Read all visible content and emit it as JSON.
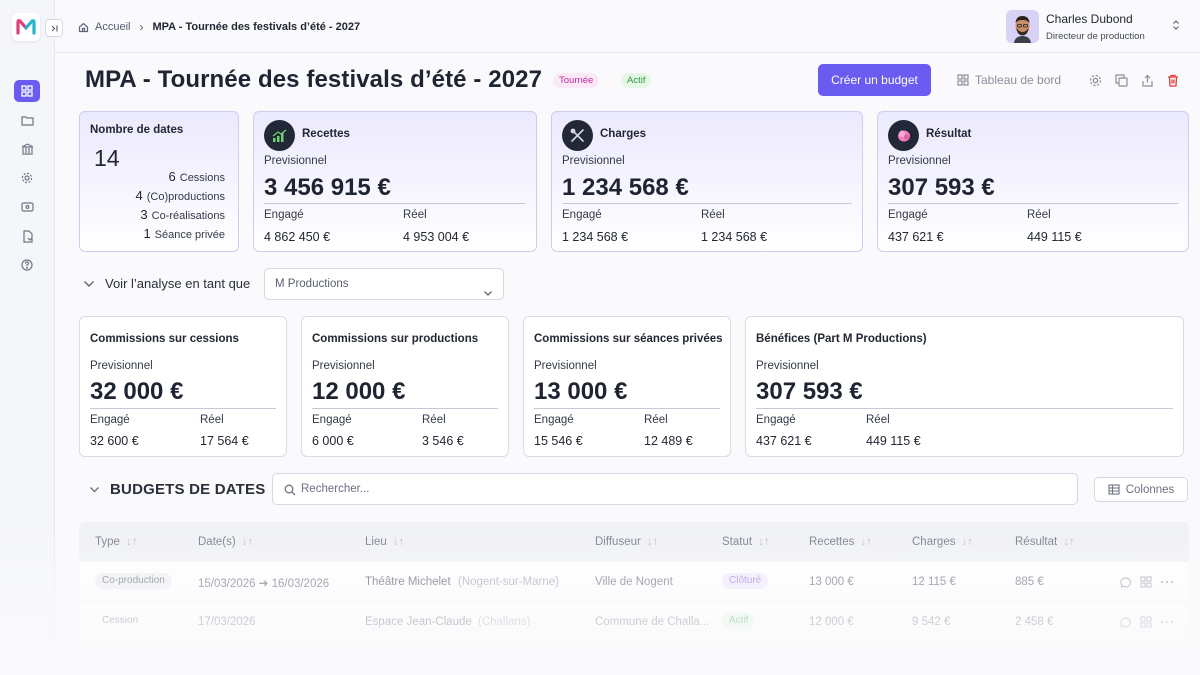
{
  "colors": {
    "accent": "#6a5cf0",
    "tag_tournee": "#c02ca0",
    "tag_actif": "#2f9a41"
  },
  "breadcrumb": {
    "home": "Accueil",
    "current": "MPA - Tournée des festivals d’été - 2027"
  },
  "user": {
    "name": "Charles Dubond",
    "role": "Directeur de production"
  },
  "header": {
    "title": "MPA - Tournée des festivals d’été - 2027",
    "tags": [
      "Tournée",
      "Actif"
    ],
    "create_button": "Créer un budget",
    "dashboard_link": "Tableau de bord"
  },
  "dates_card": {
    "title": "Nombre de dates",
    "total": "14",
    "items": [
      {
        "count": "6",
        "label": "Cessions"
      },
      {
        "count": "4",
        "label": "(Co)productions"
      },
      {
        "count": "3",
        "label": "Co-réalisations"
      },
      {
        "count": "1",
        "label": "Séance privée"
      }
    ]
  },
  "finance_cards": [
    {
      "title": "Recettes",
      "icon": "chart-up-icon",
      "prev_label": "Previsionnel",
      "prev": "3 456 915 €",
      "engage_label": "Engagé",
      "engage": "4 862 450 €",
      "reel_label": "Réel",
      "reel": "4 953 004 €"
    },
    {
      "title": "Charges",
      "icon": "tools-icon",
      "prev_label": "Previsionnel",
      "prev": "1 234 568 €",
      "engage_label": "Engagé",
      "engage": "1 234 568 €",
      "reel_label": "Réel",
      "reel": "1 234 568 €"
    },
    {
      "title": "Résultat",
      "icon": "flower-icon",
      "prev_label": "Previsionnel",
      "prev": "307 593 €",
      "engage_label": "Engagé",
      "engage": "437 621 €",
      "reel_label": "Réel",
      "reel": "449 115 €"
    }
  ],
  "analysis": {
    "label": "Voir l’analyse en tant que",
    "selected": "M Productions"
  },
  "commission_cards": [
    {
      "title": "Commissions sur cessions",
      "prev_label": "Previsionnel",
      "prev": "32 000 €",
      "engage_label": "Engagé",
      "engage": "32 600 €",
      "reel_label": "Réel",
      "reel": "17 564 €"
    },
    {
      "title": "Commissions sur productions",
      "prev_label": "Previsionnel",
      "prev": "12 000 €",
      "engage_label": "Engagé",
      "engage": "6 000 €",
      "reel_label": "Réel",
      "reel": "3 546 €"
    },
    {
      "title": "Commissions sur séances privées",
      "prev_label": "Previsionnel",
      "prev": "13 000 €",
      "engage_label": "Engagé",
      "engage": "15 546 €",
      "reel_label": "Réel",
      "reel": "12 489 €"
    },
    {
      "title": "Bénéfices (Part M Productions)",
      "prev_label": "Previsionnel",
      "prev": "307 593 €",
      "engage_label": "Engagé",
      "engage": "437 621 €",
      "reel_label": "Réel",
      "reel": "449 115 €"
    }
  ],
  "budgets": {
    "title": "BUDGETS DE DATES",
    "search_placeholder": "Rechercher...",
    "columns_button": "Colonnes",
    "headers": [
      "Type",
      "Date(s)",
      "Lieu",
      "Diffuseur",
      "Statut",
      "Recettes",
      "Charges",
      "Résultat"
    ],
    "rows": [
      {
        "type": "Co-production",
        "dates": "15/03/2026 ➔ 16/03/2026",
        "lieu": "Théâtre Michelet",
        "lieu_city": "(Nogent-sur-Marne)",
        "diffuseur": "Ville de Nogent",
        "statut": "Clôturé",
        "recettes": "13 000 €",
        "charges": "12 115 €",
        "resultat": "885 €"
      },
      {
        "type": "Cession",
        "dates": "17/03/2026",
        "lieu": "Espace Jean-Claude",
        "lieu_city": "(Challans)",
        "diffuseur": "Commune de Challa...",
        "statut": "Actif",
        "recettes": "12 000 €",
        "charges": "9 542 €",
        "resultat": "2 458 €"
      }
    ]
  }
}
